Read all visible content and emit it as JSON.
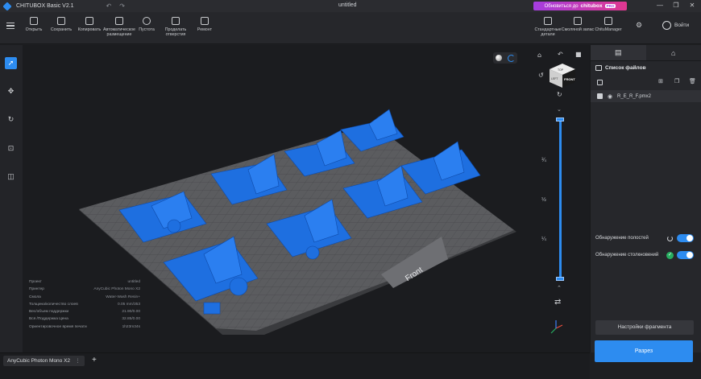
{
  "titlebar": {
    "app_name": "CHITUBOX Basic V2.1",
    "document": "untitled",
    "promo_text": "Обновиться до",
    "promo_brand": "chitubox",
    "promo_badge": "PRO"
  },
  "toolbar": {
    "tools": [
      {
        "label": "Открыть",
        "icon": "folder-icon"
      },
      {
        "label": "Сохранить",
        "icon": "save-icon"
      },
      {
        "label": "Копировать",
        "icon": "copy-icon"
      },
      {
        "label": "Автоматическое размещение",
        "icon": "auto-layout-icon"
      },
      {
        "label": "Пустота",
        "icon": "hollow-icon"
      },
      {
        "label": "Проделать отверстия",
        "icon": "dig-hole-icon"
      },
      {
        "label": "Ремонт",
        "icon": "repair-icon"
      }
    ],
    "right_tools": [
      {
        "label": "Стандартные детали",
        "icon": "standard-parts-icon"
      },
      {
        "label": "Смоляной запас",
        "icon": "resin-icon"
      },
      {
        "label": "ChituManager",
        "icon": "chitumanager-icon"
      }
    ],
    "login_label": "Войти"
  },
  "left_rail": [
    "select-icon",
    "move-icon",
    "rotate-icon",
    "scale-icon",
    "mirror-icon"
  ],
  "viewport": {
    "platform_label": "Front",
    "fractions": [
      "¾",
      "½",
      "¼"
    ],
    "info": [
      {
        "label": "Проект",
        "value": "untitled"
      },
      {
        "label": "Принтер",
        "value": "AnyCubic Photon Mono X2"
      },
      {
        "label": "Смола",
        "value": "Water-Wash Resin+"
      },
      {
        "label": "Толщина/количество слоев",
        "value": "0.05 mm/353"
      },
      {
        "label": "Вес/объем поддержки",
        "value": "21.90/0.00"
      },
      {
        "label": "Вся /Поддержка Цена",
        "value": "32.85/0.00"
      },
      {
        "label": "Ориентировочное время печати",
        "value": "1h23m34s"
      }
    ],
    "view_cube": {
      "top": "TOP",
      "front": "FRONT",
      "left": "LEFT"
    }
  },
  "right_panel": {
    "file_list_title": "Список файлов",
    "files": [
      {
        "name": "R_E_R_F.pmx2",
        "visible": true
      }
    ],
    "detect_layers": "Обнаружение полостей",
    "detect_collision": "Обнаружение столкновений",
    "fragment_settings": "Настройки фрагмента",
    "slice_button": "Разрез"
  },
  "bottom": {
    "printer_tab": "AnyCubic Photon Mono X2"
  },
  "colors": {
    "accent": "#2d8cf0",
    "model": "#1e6fe0",
    "plate": "#5b5c5f",
    "promo_start": "#a43de0",
    "promo_end": "#e0388f"
  }
}
